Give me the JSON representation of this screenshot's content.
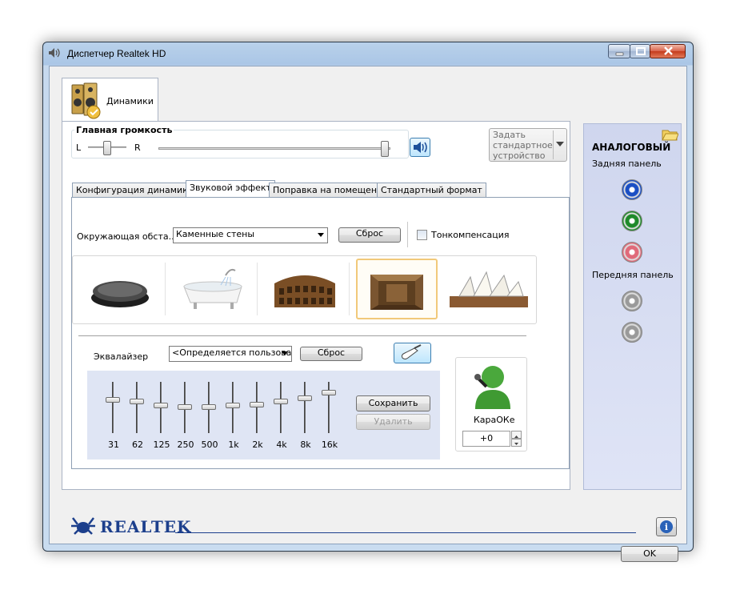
{
  "window": {
    "title": "Диспетчер Realtek HD"
  },
  "device_tab": {
    "label": "Динамики"
  },
  "volume": {
    "group_label": "Главная громкость",
    "left": "L",
    "right": "R",
    "balance": 0.5,
    "level": 1.0
  },
  "default_device_button": "Задать стандартное устройство",
  "tabs": [
    {
      "label": "Конфигурация динамиков",
      "active": false
    },
    {
      "label": "Звуковой эффект",
      "active": true
    },
    {
      "label": "Поправка на помещение",
      "active": false
    },
    {
      "label": "Стандартный формат",
      "active": false
    }
  ],
  "environment": {
    "label": "Окружающая обста...",
    "value": "Каменные стены",
    "reset": "Сброс",
    "loudness_label": "Тонкомпенсация",
    "loudness_checked": false,
    "presets": [
      {
        "icon": "stone-disc-icon",
        "selected": false
      },
      {
        "icon": "bathtub-icon",
        "selected": false
      },
      {
        "icon": "colosseum-icon",
        "selected": false
      },
      {
        "icon": "stone-walls-icon",
        "selected": true
      },
      {
        "icon": "opera-house-icon",
        "selected": false
      }
    ]
  },
  "equalizer": {
    "label": "Эквалайзер",
    "value": "<Определяется пользова",
    "reset": "Сброс",
    "bands": [
      "31",
      "62",
      "125",
      "250",
      "500",
      "1k",
      "2k",
      "4k",
      "8k",
      "16k"
    ],
    "levels": [
      0.35,
      0.38,
      0.45,
      0.48,
      0.48,
      0.45,
      0.43,
      0.38,
      0.32,
      0.2
    ],
    "save": "Сохранить",
    "delete": "Удалить"
  },
  "karaoke": {
    "label": "КараОКе",
    "value": "+0"
  },
  "side": {
    "title": "АНАЛОГОВЫЙ",
    "rear_label": "Задняя панель",
    "front_label": "Передняя панель",
    "rear_jacks": [
      "#1b4fc4",
      "#1f8a2a",
      "#e06a7a"
    ],
    "front_jacks": [
      "#9a9a9a",
      "#9a9a9a"
    ]
  },
  "footer": {
    "brand": "REALTEK",
    "ok": "OK"
  }
}
